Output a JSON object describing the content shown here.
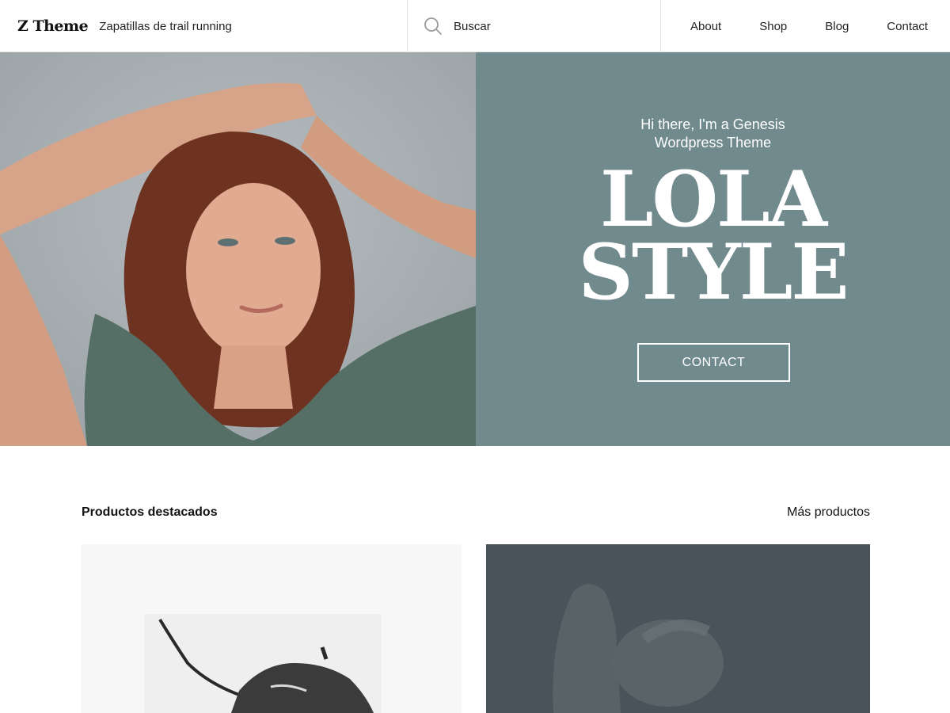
{
  "header": {
    "logo": "Z Theme",
    "tagline": "Zapatillas de trail running",
    "search": {
      "placeholder": "Buscar",
      "icon": "search-icon"
    },
    "nav": [
      "About",
      "Shop",
      "Blog",
      "Contact"
    ]
  },
  "hero": {
    "intro_line1": "Hi there, I'm a Genesis",
    "intro_line2": "Wordpress Theme",
    "title_line1": "LOLA",
    "title_line2": "STYLE",
    "button_label": "CONTACT",
    "panel_color": "#708a8d"
  },
  "featured": {
    "title": "Productos destacados",
    "more_link": "Más productos"
  }
}
